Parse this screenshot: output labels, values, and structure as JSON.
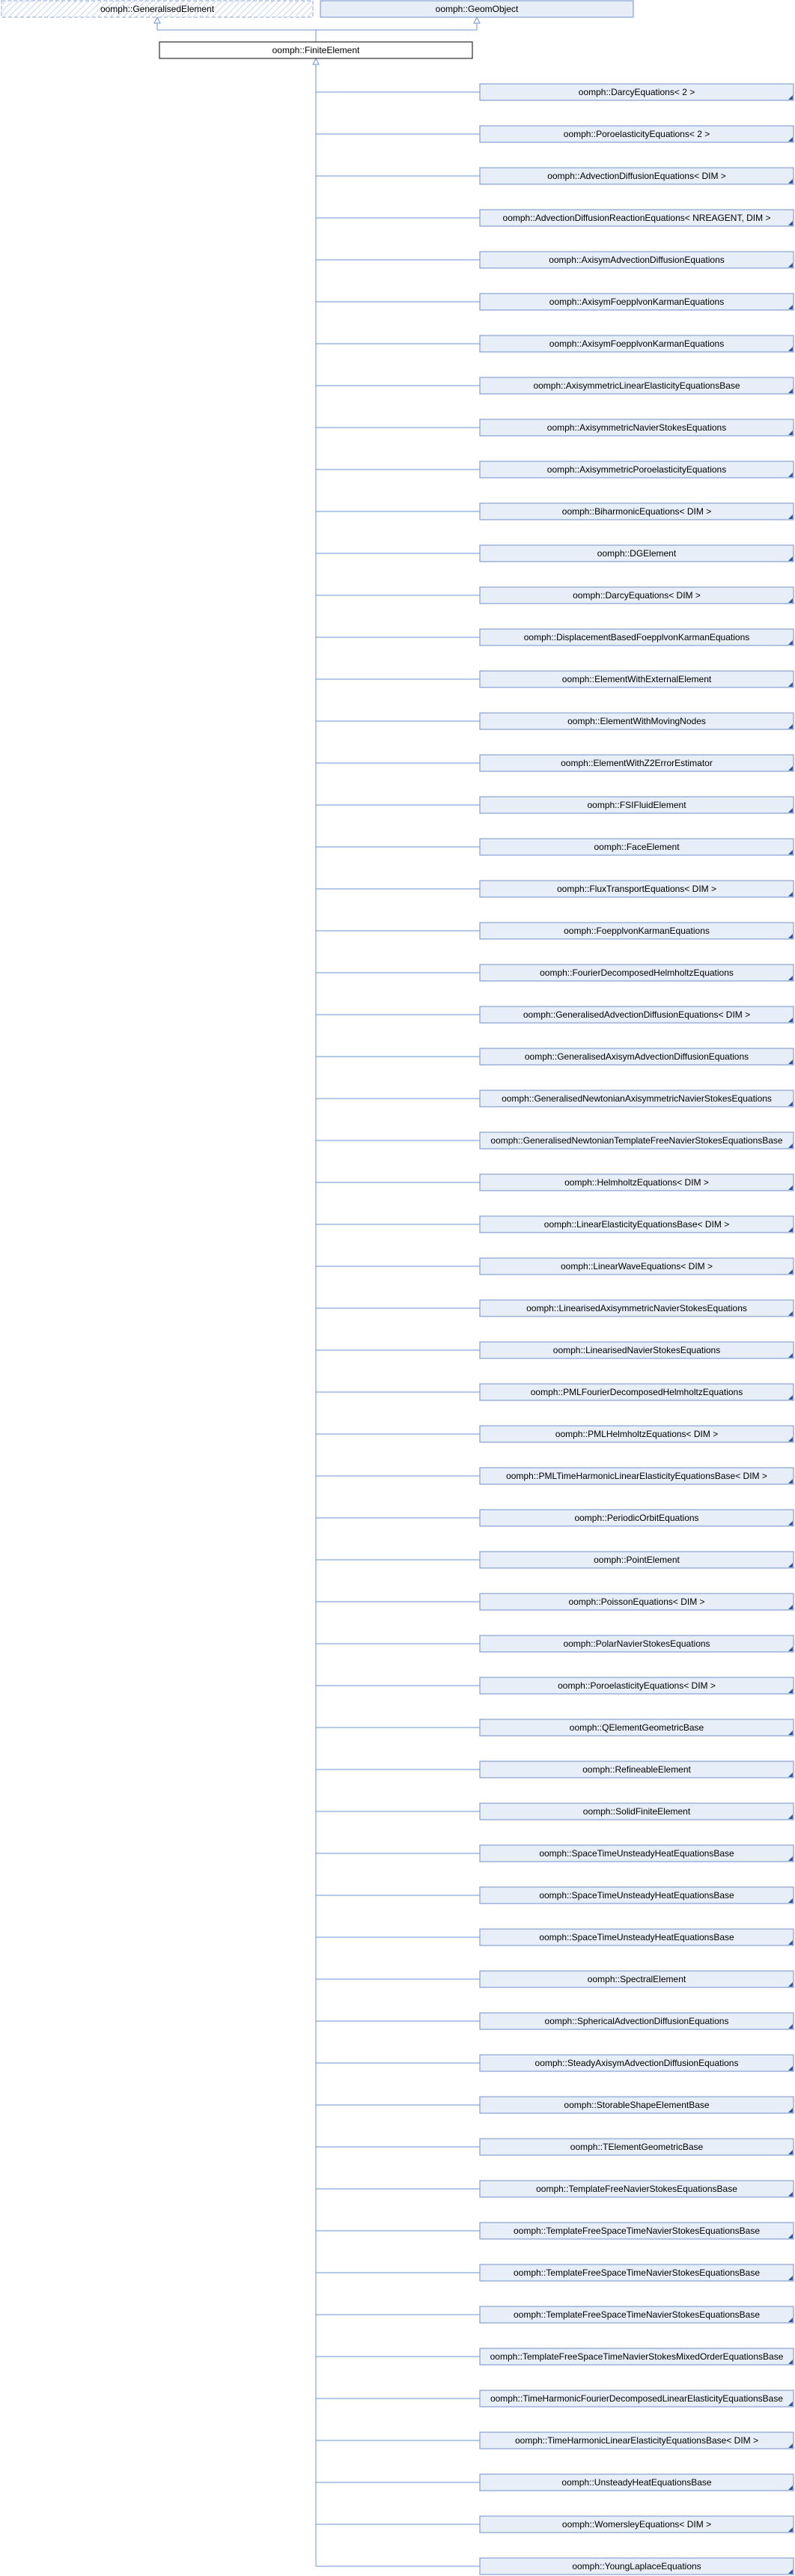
{
  "parents": [
    {
      "label": "oomph::GeneralisedElement",
      "style": "hatched"
    },
    {
      "label": "oomph::GeomObject",
      "style": "blue"
    }
  ],
  "root": {
    "label": "oomph::FiniteElement"
  },
  "children": [
    "oomph::DarcyEquations< 2 >",
    "oomph::PoroelasticityEquations< 2 >",
    "oomph::AdvectionDiffusionEquations< DIM >",
    "oomph::AdvectionDiffusionReactionEquations< NREAGENT, DIM >",
    "oomph::AxisymAdvectionDiffusionEquations",
    "oomph::AxisymFoepplvonKarmanEquations",
    "oomph::AxisymFoepplvonKarmanEquations",
    "oomph::AxisymmetricLinearElasticityEquationsBase",
    "oomph::AxisymmetricNavierStokesEquations",
    "oomph::AxisymmetricPoroelasticityEquations",
    "oomph::BiharmonicEquations< DIM >",
    "oomph::DGElement",
    "oomph::DarcyEquations< DIM >",
    "oomph::DisplacementBasedFoepplvonKarmanEquations",
    "oomph::ElementWithExternalElement",
    "oomph::ElementWithMovingNodes",
    "oomph::ElementWithZ2ErrorEstimator",
    "oomph::FSIFluidElement",
    "oomph::FaceElement",
    "oomph::FluxTransportEquations< DIM >",
    "oomph::FoepplvonKarmanEquations",
    "oomph::FourierDecomposedHelmholtzEquations",
    "oomph::GeneralisedAdvectionDiffusionEquations< DIM >",
    "oomph::GeneralisedAxisymAdvectionDiffusionEquations",
    "oomph::GeneralisedNewtonianAxisymmetricNavierStokesEquations",
    "oomph::GeneralisedNewtonianTemplateFreeNavierStokesEquationsBase",
    "oomph::HelmholtzEquations< DIM >",
    "oomph::LinearElasticityEquationsBase< DIM >",
    "oomph::LinearWaveEquations< DIM >",
    "oomph::LinearisedAxisymmetricNavierStokesEquations",
    "oomph::LinearisedNavierStokesEquations",
    "oomph::PMLFourierDecomposedHelmholtzEquations",
    "oomph::PMLHelmholtzEquations< DIM >",
    "oomph::PMLTimeHarmonicLinearElasticityEquationsBase< DIM >",
    "oomph::PeriodicOrbitEquations",
    "oomph::PointElement",
    "oomph::PoissonEquations< DIM >",
    "oomph::PolarNavierStokesEquations",
    "oomph::PoroelasticityEquations< DIM >",
    "oomph::QElementGeometricBase",
    "oomph::RefineableElement",
    "oomph::SolidFiniteElement",
    "oomph::SpaceTimeUnsteadyHeatEquationsBase",
    "oomph::SpaceTimeUnsteadyHeatEquationsBase",
    "oomph::SpaceTimeUnsteadyHeatEquationsBase",
    "oomph::SpectralElement",
    "oomph::SphericalAdvectionDiffusionEquations",
    "oomph::SteadyAxisymAdvectionDiffusionEquations",
    "oomph::StorableShapeElementBase",
    "oomph::TElementGeometricBase",
    "oomph::TemplateFreeNavierStokesEquationsBase",
    "oomph::TemplateFreeSpaceTimeNavierStokesEquationsBase",
    "oomph::TemplateFreeSpaceTimeNavierStokesEquationsBase",
    "oomph::TemplateFreeSpaceTimeNavierStokesEquationsBase",
    "oomph::TemplateFreeSpaceTimeNavierStokesMixedOrderEquationsBase",
    "oomph::TimeHarmonicFourierDecomposedLinearElasticityEquationsBase",
    "oomph::TimeHarmonicLinearElasticityEquationsBase< DIM >",
    "oomph::UnsteadyHeatEquationsBase",
    "oomph::WomersleyEquations< DIM >",
    "oomph::YoungLaplaceEquations"
  ],
  "colors": {
    "box_fill": "#e8eef8",
    "box_stroke": "#7090c8",
    "line": "#6b96d0",
    "root_stroke": "#000000",
    "hatch": "#a8b8e0"
  }
}
